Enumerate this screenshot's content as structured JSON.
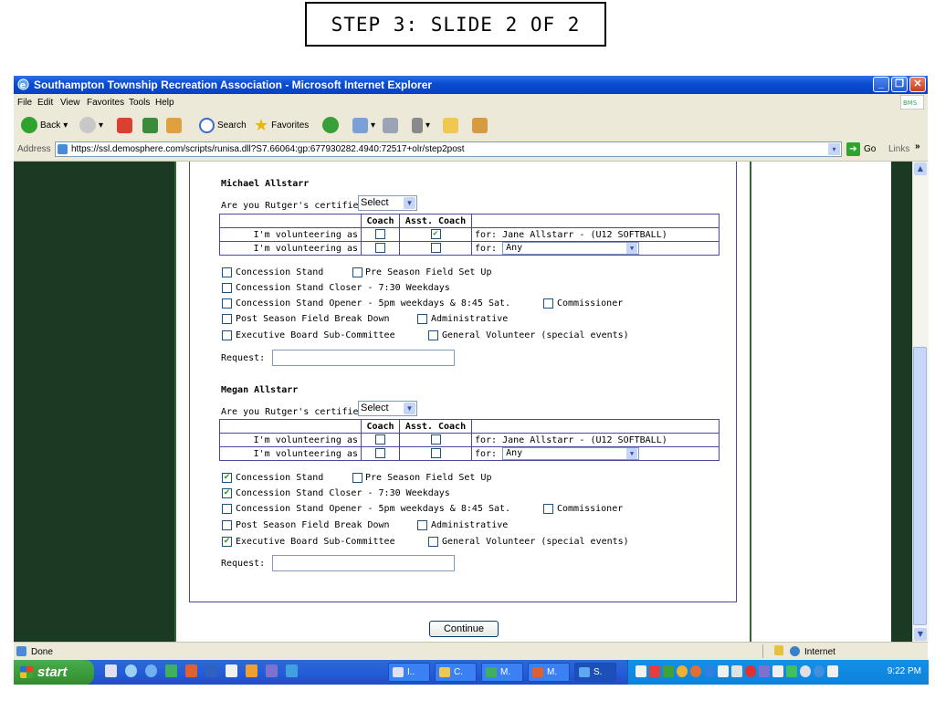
{
  "slide_caption": "STEP 3:  SLIDE 2 OF 2",
  "window": {
    "title": "Southampton Township Recreation Association - Microsoft Internet Explorer"
  },
  "menu": [
    "File",
    "Edit",
    "View",
    "Favorites",
    "Tools",
    "Help"
  ],
  "toolbar": {
    "back_label": "Back",
    "search_label": "Search",
    "favorites_label": "Favorites"
  },
  "address": {
    "label": "Address",
    "url": "https://ssl.demosphere.com/scripts/runisa.dll?S7.66064:gp:677930282.4940:72517+olr/step2post",
    "go_label": "Go",
    "links_label": "Links"
  },
  "form": {
    "certified_question": "Are you Rutger's certified?",
    "select_default": "Select",
    "col_coach": "Coach",
    "col_asst_coach": "Asst. Coach",
    "volunteering_label": "I'm volunteering as",
    "for_label": "for:",
    "request_label": "Request:",
    "continue_label": "Continue",
    "people": [
      {
        "name": "Michael Allstarr",
        "rows": [
          {
            "coach": false,
            "asst": true,
            "for_text": "Jane Allstarr - (U12 SOFTBALL)"
          },
          {
            "coach": false,
            "asst": false,
            "for_select": "Any"
          }
        ],
        "options": {
          "concession_stand": false,
          "pre_season": false,
          "closer": false,
          "opener": false,
          "commissioner": false,
          "post_season": false,
          "administrative": false,
          "exec_board": false,
          "general": false
        }
      },
      {
        "name": "Megan Allstarr",
        "rows": [
          {
            "coach": false,
            "asst": false,
            "for_text": "Jane Allstarr - (U12 SOFTBALL)"
          },
          {
            "coach": false,
            "asst": false,
            "for_select": "Any"
          }
        ],
        "options": {
          "concession_stand": true,
          "pre_season": false,
          "closer": true,
          "opener": false,
          "commissioner": false,
          "post_season": false,
          "administrative": false,
          "exec_board": true,
          "general": false
        }
      }
    ],
    "option_labels": {
      "concession_stand": "Concession Stand",
      "pre_season": "Pre Season Field Set Up",
      "closer": "Concession Stand Closer - 7:30 Weekdays",
      "opener": "Concession Stand Opener - 5pm weekdays & 8:45 Sat.",
      "commissioner": "Commissioner",
      "post_season": "Post Season Field Break Down",
      "administrative": "Administrative",
      "exec_board": "Executive Board Sub-Committee",
      "general": "General Volunteer (special events)"
    }
  },
  "status": {
    "left": "Done",
    "zone": "Internet"
  },
  "taskbar": {
    "start_label": "start",
    "tasks": [
      "I..",
      "C.",
      "M.",
      "M.",
      "S."
    ],
    "clock": "9:22 PM"
  }
}
